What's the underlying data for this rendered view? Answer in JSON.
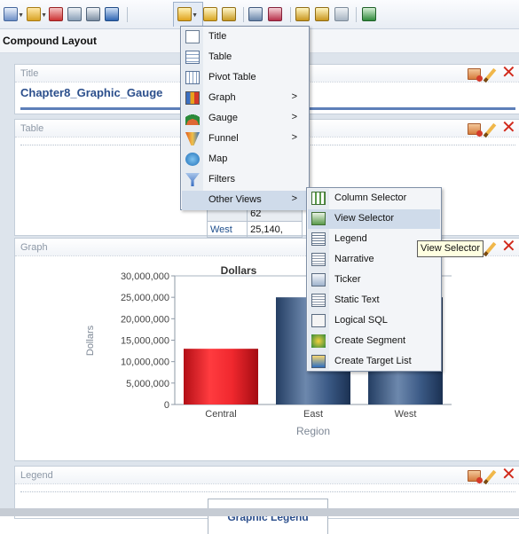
{
  "section_header": {
    "title": "Compound Layout"
  },
  "sections": {
    "title": {
      "label": "Title",
      "report_title": "Chapter8_Graphic_Gauge"
    },
    "table": {
      "label": "Table",
      "rows": [
        {
          "region": "",
          "value": "62"
        },
        {
          "region": "West",
          "value": "25,140,"
        }
      ]
    },
    "graph": {
      "label": "Graph"
    },
    "legend": {
      "label": "Legend",
      "box_title": "Graphic Legend"
    }
  },
  "chart_data": {
    "type": "bar",
    "title": "Dollars",
    "categories": [
      "Central",
      "East",
      "West"
    ],
    "values": [
      13000000,
      25000000,
      25000000
    ],
    "ylabel": "Dollars",
    "xlabel": "Region",
    "ylim": [
      0,
      30000000
    ],
    "yticks": [
      "0",
      "5,000,000",
      "10,000,000",
      "15,000,000",
      "20,000,000",
      "25,000,000",
      "30,000,000"
    ],
    "colors": [
      "#e8242a",
      "#2f4f7c",
      "#2f4f7c"
    ],
    "grid": false
  },
  "menu": {
    "items": [
      {
        "label": "Title",
        "icon": "title-icon",
        "submenu": false
      },
      {
        "label": "Table",
        "icon": "table-icon",
        "submenu": false
      },
      {
        "label": "Pivot Table",
        "icon": "pivot-table-icon",
        "submenu": false
      },
      {
        "label": "Graph",
        "icon": "graph-icon",
        "submenu": true
      },
      {
        "label": "Gauge",
        "icon": "gauge-icon",
        "submenu": true
      },
      {
        "label": "Funnel",
        "icon": "funnel-icon",
        "submenu": true
      },
      {
        "label": "Map",
        "icon": "map-icon",
        "submenu": false
      },
      {
        "label": "Filters",
        "icon": "filters-icon",
        "submenu": false
      },
      {
        "label": "Other Views",
        "icon": "",
        "submenu": true
      }
    ],
    "arrow": ">"
  },
  "submenu": {
    "items": [
      {
        "label": "Column Selector",
        "icon": "column-selector-icon"
      },
      {
        "label": "View Selector",
        "icon": "view-selector-icon"
      },
      {
        "label": "Legend",
        "icon": "legend-icon"
      },
      {
        "label": "Narrative",
        "icon": "narrative-icon"
      },
      {
        "label": "Ticker",
        "icon": "ticker-icon"
      },
      {
        "label": "Static Text",
        "icon": "static-text-icon"
      },
      {
        "label": "Logical SQL",
        "icon": "logical-sql-icon"
      },
      {
        "label": "Create Segment",
        "icon": "create-segment-icon"
      },
      {
        "label": "Create Target List",
        "icon": "create-target-list-icon"
      }
    ]
  },
  "tooltip": {
    "text": "View Selector"
  },
  "colors": {
    "accent": "#5d7fb9",
    "title_blue": "#2c4f8c",
    "close_red": "#d12a1c",
    "bar_red": "#e8242a",
    "bar_blue": "#2f4f7c",
    "menu_highlight": "#cfdbea"
  }
}
